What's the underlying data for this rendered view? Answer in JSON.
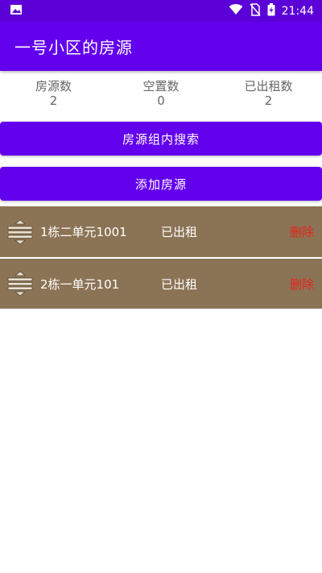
{
  "status_bar": {
    "time": "21:44",
    "icons": [
      "image-icon",
      "wifi-icon",
      "no-sim-icon",
      "battery-charging-icon"
    ]
  },
  "app_bar": {
    "title": "一号小区的房源"
  },
  "stats": [
    {
      "label": "房源数",
      "value": "2"
    },
    {
      "label": "空置数",
      "value": "0"
    },
    {
      "label": "已出租数",
      "value": "2"
    }
  ],
  "buttons": {
    "search_label": "房源组内搜索",
    "add_label": "添加房源"
  },
  "listings": [
    {
      "name": "1栋二单元1001",
      "status": "已出租",
      "delete_label": "删除"
    },
    {
      "name": "2栋一单元101",
      "status": "已出租",
      "delete_label": "删除"
    }
  ],
  "colors": {
    "primary": "#6200ee",
    "status_bar": "#5b00d6",
    "row_background": "#8b7355",
    "delete_red": "#e8241b"
  }
}
